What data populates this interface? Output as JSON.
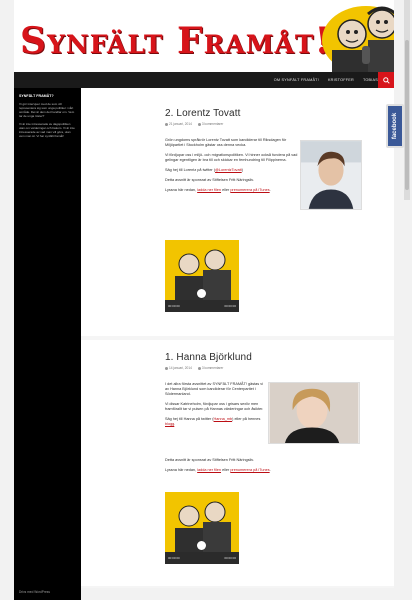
{
  "site": {
    "title": "Synfält Framåt!"
  },
  "nav": {
    "items": [
      {
        "label": "Om Synfält Framåt!"
      },
      {
        "label": "Kristoffer"
      },
      {
        "label": "Tobias"
      }
    ],
    "search_icon": "search-icon"
  },
  "sidebar": {
    "widget_title": "Synfält Framåt?",
    "text1": "Vi gör intervjuer med de som vill representera sig som unga politiker i vårt område. Det är dem det handlar om. Vem tar de unga röster?",
    "text2": "Vi är inte intresserade av dagspolitiken utan om värderingar och bakom. Vi är inte intresserade av vad man vill göra, utan vem man är. Vi har synfält framåt!",
    "footer": "Drivs med WordPress"
  },
  "posts": [
    {
      "title": "2. Lorentz Tovatt",
      "date": "21 januari, 2014",
      "comments": "3 kommentarer",
      "p1": "Grön ungdoms språkrör Lorentz Tovatt som kandiderar till Riksdagen för Miljöpartiet i Stockholm gästar oss denna vecka.",
      "p2": "Vi fördjupar oss i miljö- och migrationspolitiken. Vi hinner också fundera på vad gelingar egentligen är bra till och skickar en femhundring till Filippinerna.",
      "twitter_pre": "Säg hej till Lorentz på twitter (",
      "twitter_link": "@LorentzTovatt",
      "twitter_post": ")",
      "sponsor": "Detta avsnitt är sponsrat av Stiftelsen Fritt Näringsliv.",
      "listen_pre": "Lyssna här nedan, ",
      "listen_link1": "ladda ner filen",
      "listen_mid": " eller ",
      "listen_link2": "prenumerera på iTunes",
      "listen_post": ".",
      "time_start": "00:00:00",
      "time_end": "00:00:00"
    },
    {
      "title": "1. Hanna Björklund",
      "date": "14 januari, 2014",
      "comments": "3 kommentarer",
      "p1": "I det allra första avsnittet av SYNFÄLT FRAMÅT! gästas vi av Hanna Björklund som kandiderar för Centerpartiet i Södermanland.",
      "p2": "Vi dissar Katrineholm, fördjupar oss i grisars sexliv men framförallt tar vi pulsen på Hannas värderingar och åsikter.",
      "twitter_pre": "Säg hej till Hanna på twitter (",
      "twitter_link": "Hanna_mb",
      "twitter_post": ") eller på hennes ",
      "blog_link": "blogg",
      "blog_post": ".",
      "sponsor": "Detta avsnitt är sponsrat av Stiftelsen Fritt Näringsliv.",
      "listen_pre": "Lyssna här nedan, ",
      "listen_link1": "ladda ner filen",
      "listen_mid": " eller ",
      "listen_link2": "prenumerera på iTunes",
      "listen_post": ".",
      "time_start": "00:00:00",
      "time_end": "00:00:00"
    }
  ],
  "facebook": {
    "label": "facebook"
  },
  "colors": {
    "accent": "#d7141a",
    "nav_bg": "#1a1a1a",
    "facebook": "#3b5998"
  }
}
